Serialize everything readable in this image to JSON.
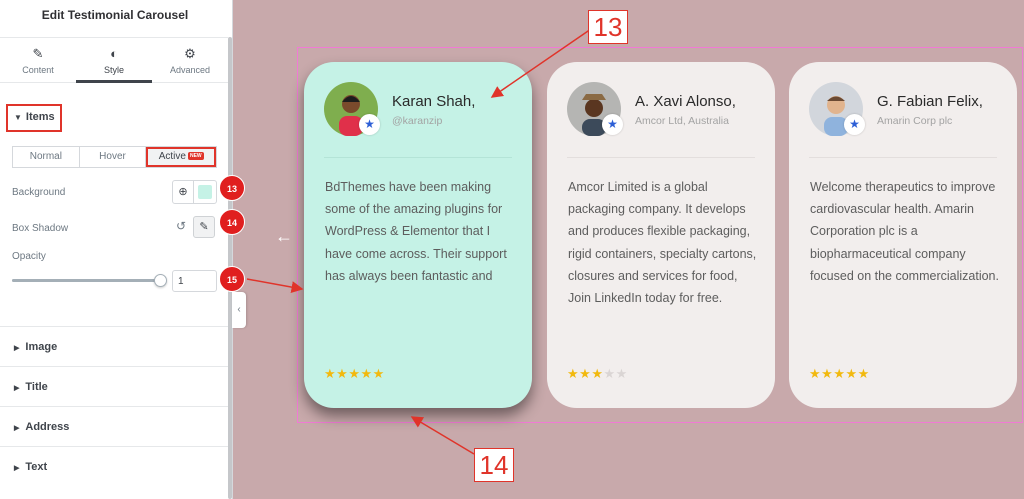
{
  "panel": {
    "title": "Edit Testimonial Carousel",
    "tabs": [
      {
        "label": "Content",
        "icon": "pencil-icon"
      },
      {
        "label": "Style",
        "icon": "half-circle-icon"
      },
      {
        "label": "Advanced",
        "icon": "gear-icon"
      }
    ],
    "items_section": "Items",
    "state_tabs": [
      "Normal",
      "Hover",
      "Active"
    ],
    "new_badge": "NEW",
    "background_label": "Background",
    "box_shadow_label": "Box Shadow",
    "opacity_label": "Opacity",
    "opacity_value": "1",
    "opacity_slider_fraction": 1,
    "swatch_color": "#c5f2e6",
    "sections": [
      "Image",
      "Title",
      "Address",
      "Text"
    ]
  },
  "annotations": {
    "badge_13": "13",
    "badge_14": "14",
    "badge_15": "15",
    "label_top": "13",
    "label_bottom": "14",
    "accent": "#e0342a"
  },
  "carousel": {
    "cards": [
      {
        "name": "Karan Shah,",
        "address": "@karanzip",
        "text": "BdThemes have been making some of the amazing plugins for WordPress & Elementor that I have come across. Their support has always been fantastic and",
        "rating": 5,
        "active": true
      },
      {
        "name": "A. Xavi Alonso,",
        "address": "Amcor Ltd, Australia",
        "text": "Amcor Limited is a global packaging company. It develops and produces flexible packaging, rigid containers, specialty cartons, closures and services for food, Join LinkedIn today for free.",
        "rating": 3,
        "active": false
      },
      {
        "name": "G. Fabian Felix,",
        "address": "Amarin Corp plc",
        "text": "Welcome therapeutics to improve cardiovascular health. Amarin Corporation plc is a biopharmaceutical company focused on the commercialization.",
        "rating": 5,
        "active": false
      }
    ]
  }
}
